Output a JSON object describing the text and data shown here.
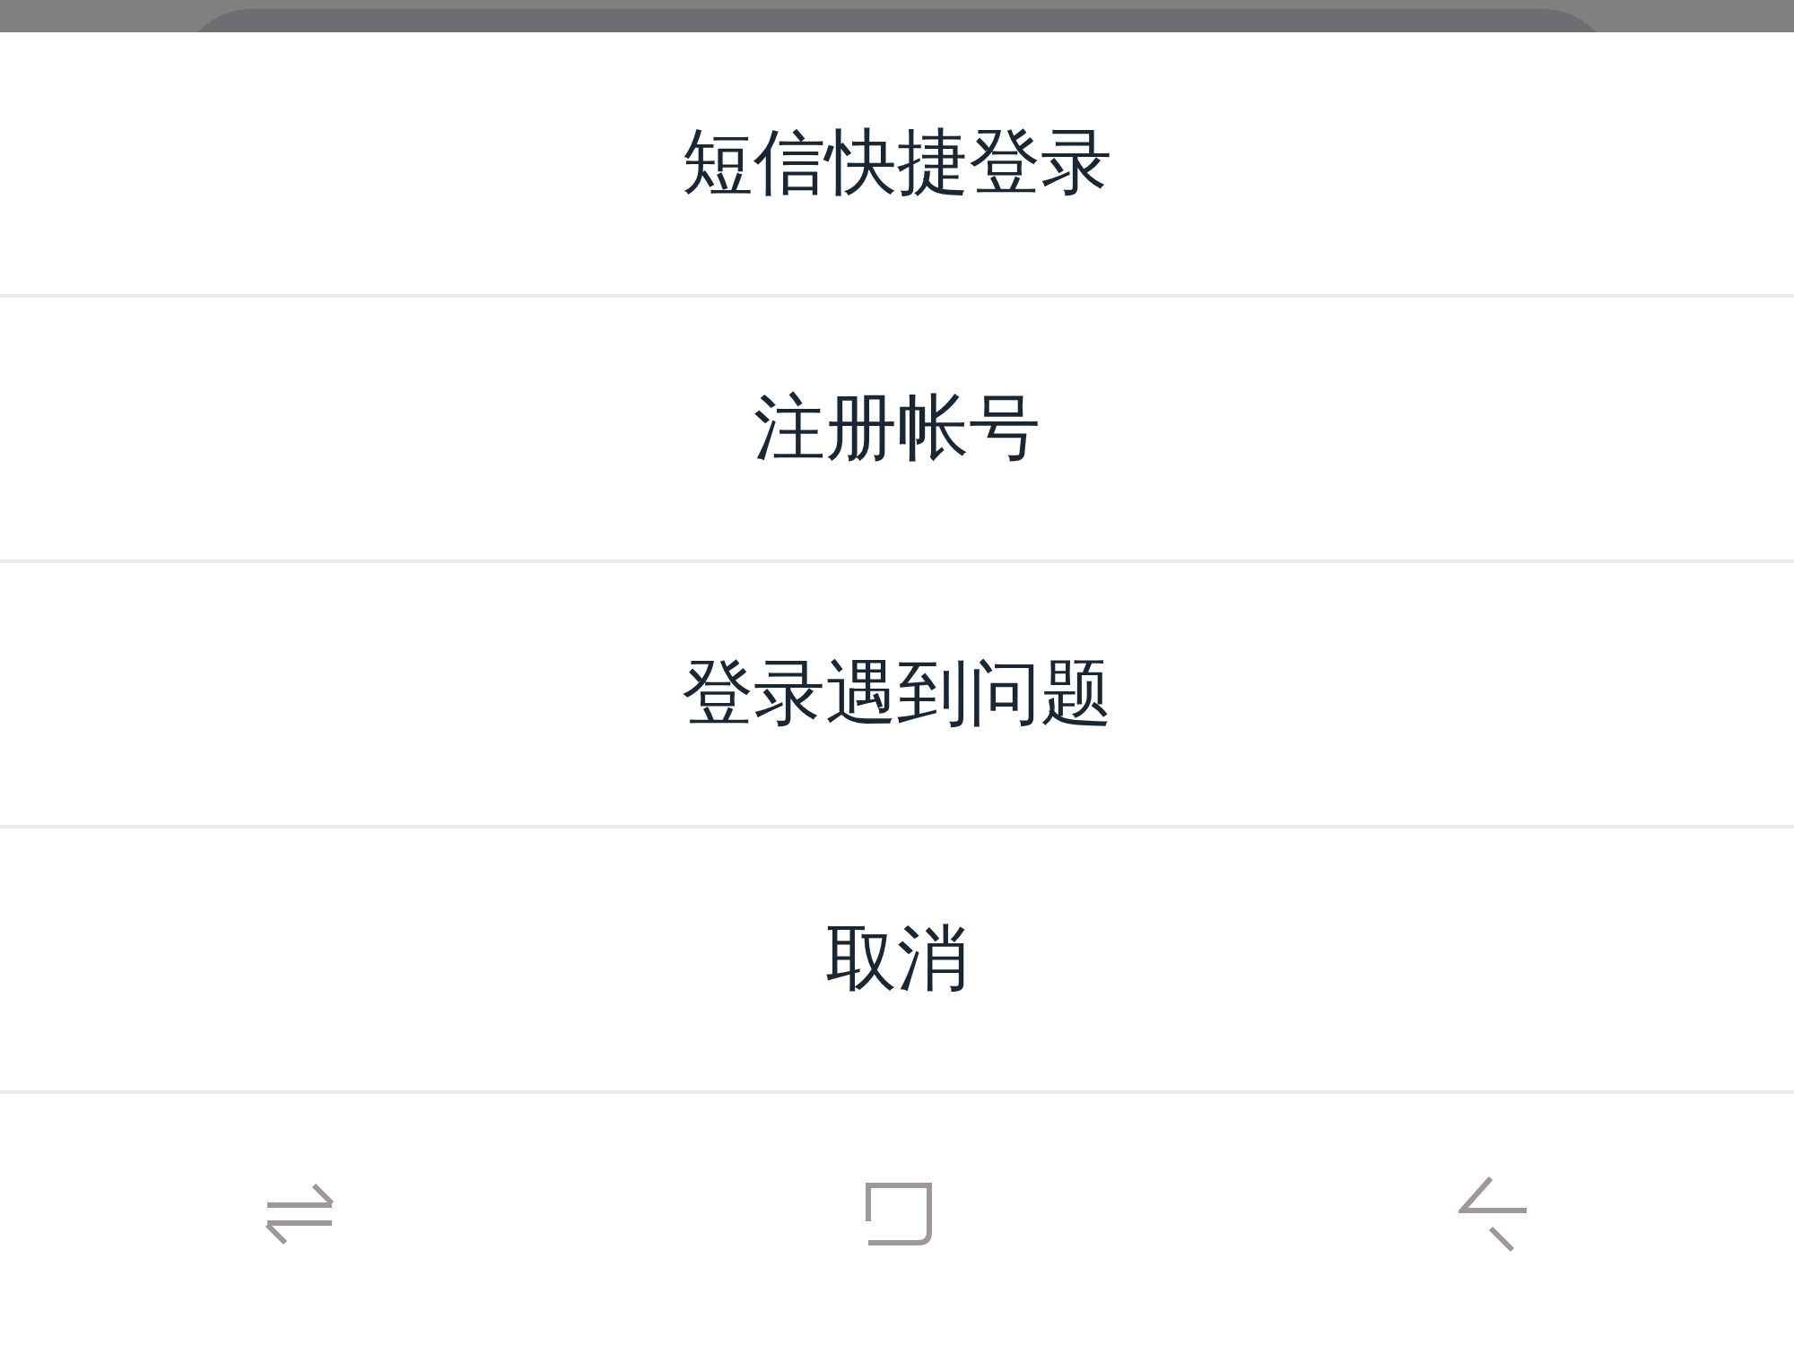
{
  "action_sheet": {
    "options": [
      {
        "label": "短信快捷登录"
      },
      {
        "label": "注册帐号"
      },
      {
        "label": "登录遇到问题"
      },
      {
        "label": "取消"
      }
    ]
  }
}
